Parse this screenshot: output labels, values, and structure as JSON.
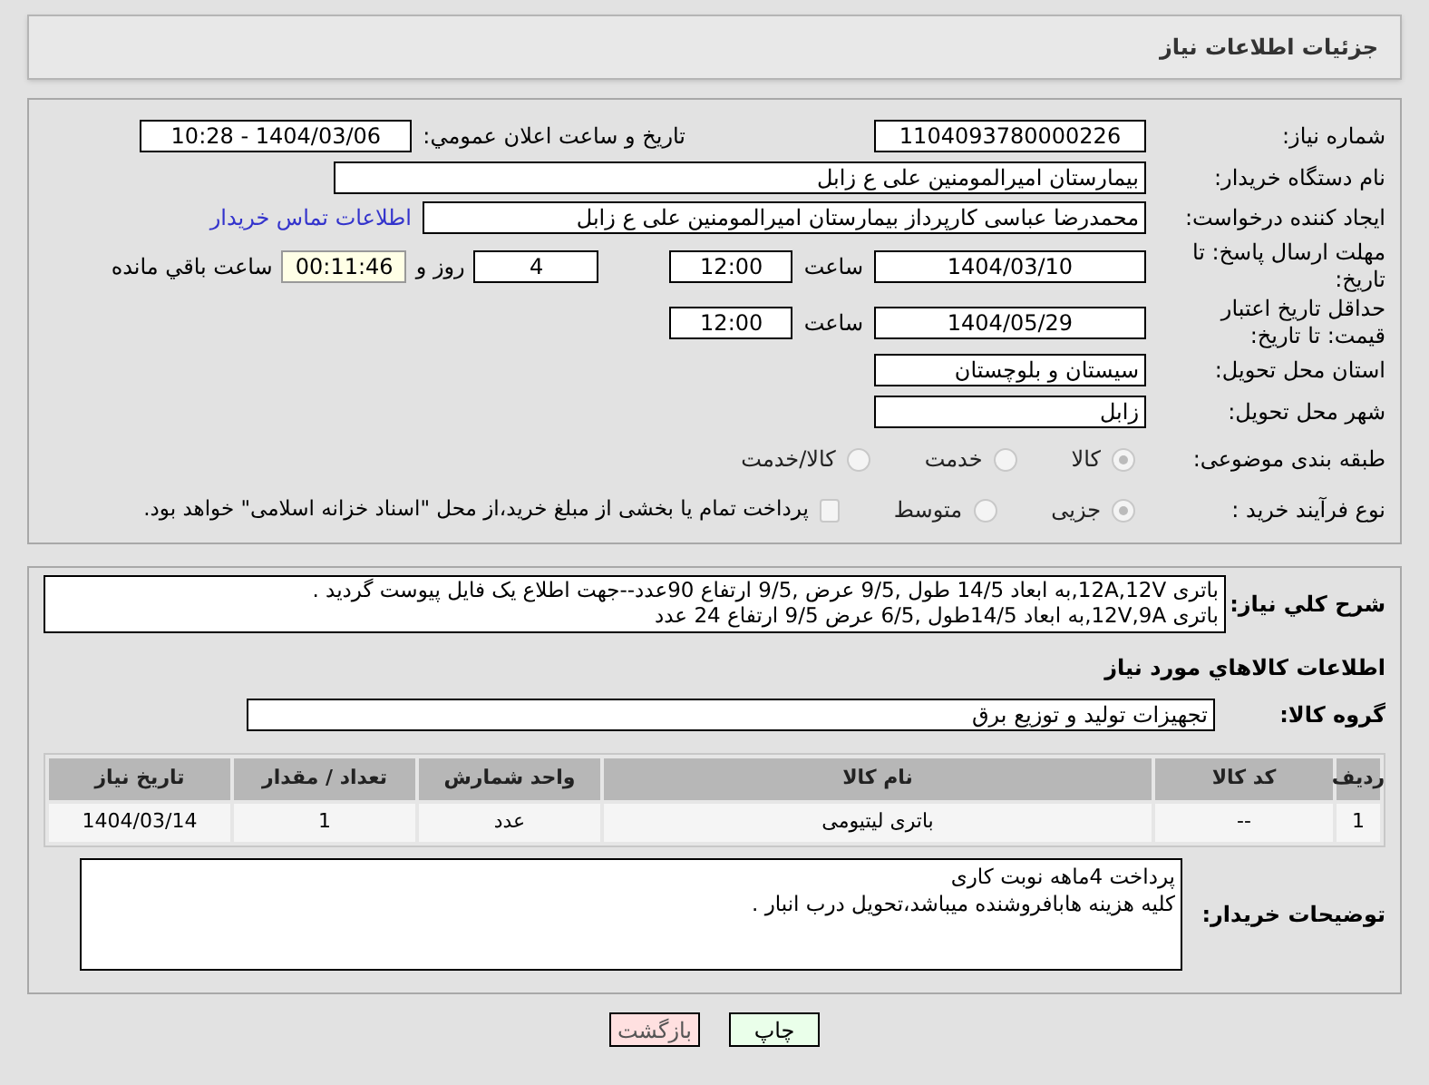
{
  "header": {
    "title": "جزئیات اطلاعات نیاز"
  },
  "need_number": {
    "label": "شماره نیاز:",
    "value": "1104093780000226"
  },
  "announce": {
    "label": "تاریخ و ساعت اعلان عمومي:",
    "value": "1404/03/06 - 10:28"
  },
  "buyer_org": {
    "label": "نام دستگاه خریدار:",
    "value": "بیمارستان امیرالمومنین علی  ع  زابل"
  },
  "requester": {
    "label": "ایجاد کننده درخواست:",
    "value": "محمدرضا عباسی کارپرداز بیمارستان امیرالمومنین علی  ع  زابل",
    "link": "اطلاعات تماس خریدار"
  },
  "deadline": {
    "label": "مهلت ارسال پاسخ: تا تاریخ:",
    "date": "1404/03/10",
    "time_label": "ساعت",
    "time": "12:00",
    "days": "4",
    "days_label": "روز و",
    "remaining": "00:11:46",
    "remaining_label": "ساعت باقي مانده"
  },
  "validity": {
    "label": "حداقل تاریخ اعتبار قیمت: تا تاریخ:",
    "date": "1404/05/29",
    "time_label": "ساعت",
    "time": "12:00"
  },
  "province": {
    "label": "استان محل تحویل:",
    "value": "سیستان و بلوچستان"
  },
  "city": {
    "label": "شهر محل تحویل:",
    "value": "زابل"
  },
  "category": {
    "label": "طبقه بندی موضوعی:",
    "options": [
      {
        "label": "كالا",
        "selected": true
      },
      {
        "label": "خدمت",
        "selected": false
      },
      {
        "label": "كالا/خدمت",
        "selected": false
      }
    ]
  },
  "process": {
    "label": "نوع فرآیند خرید :",
    "options": [
      {
        "label": "جزیی",
        "selected": true
      },
      {
        "label": "متوسط",
        "selected": false
      }
    ],
    "treasury": {
      "label": "پرداخت تمام یا بخشی از مبلغ خرید،از محل \"اسناد خزانه اسلامی\" خواهد بود.",
      "checked": false
    }
  },
  "description": {
    "label": "شرح كلي نیاز:",
    "value": "باتری 12A,12V,به ابعاد 14/5 طول ,9/5 عرض ,9/5 ارتفاع 90عدد--جهت اطلاع یک فایل پیوست گردید .\nباتری 12V,9A,به ابعاد 14/5طول ,6/5 عرض 9/5 ارتفاع  24 عدد"
  },
  "goods_heading": "اطلاعات كالاهاي مورد نياز",
  "goods_group": {
    "label": "گروه کالا:",
    "value": "تجهیزات تولید و توزیع برق"
  },
  "table": {
    "columns": [
      "ردیف",
      "کد کالا",
      "نام کالا",
      "واحد شمارش",
      "تعداد / مقدار",
      "تاریخ نیاز"
    ],
    "rows": [
      [
        "1",
        "--",
        "باتری لیتیومی",
        "عدد",
        "1",
        "1404/03/14"
      ]
    ]
  },
  "buyer_notes": {
    "label": "توضیحات خریدار:",
    "value": "پرداخت 4ماهه نوبت کاری\nکلیه هزینه هابافروشنده میباشد،تحویل درب انبار ."
  },
  "buttons": [
    {
      "label": "چاپ",
      "kind": "print"
    },
    {
      "label": "بازگشت",
      "kind": "back"
    }
  ]
}
